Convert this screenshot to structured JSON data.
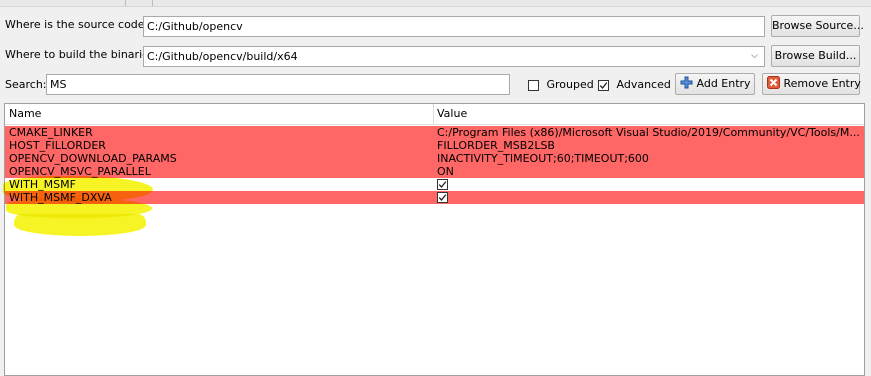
{
  "source": {
    "label": "Where is the source code:",
    "value": "C:/Github/opencv",
    "browse_label": "Browse Source..."
  },
  "build": {
    "label": "Where to build the binaries:",
    "value": "C:/Github/opencv/build/x64",
    "browse_label": "Browse Build..."
  },
  "search": {
    "label": "Search:",
    "value": "MS"
  },
  "options": {
    "grouped_label": "Grouped",
    "grouped_checked": false,
    "advanced_label": "Advanced",
    "advanced_checked": true
  },
  "toolbar": {
    "add_entry_label": "Add Entry",
    "remove_entry_label": "Remove Entry"
  },
  "table": {
    "columns": [
      "Name",
      "Value"
    ],
    "rows": [
      {
        "name": "CMAKE_LINKER",
        "value": "C:/Program Files (x86)/Microsoft Visual Studio/2019/Community/VC/Tools/M...",
        "color": "#ff6666"
      },
      {
        "name": "HOST_FILLORDER",
        "value": "FILLORDER_MSB2LSB",
        "color": "#ff6666"
      },
      {
        "name": "OPENCV_DOWNLOAD_PARAMS",
        "value": "INACTIVITY_TIMEOUT;60;TIMEOUT;600",
        "color": "#ff6666"
      },
      {
        "name": "OPENCV_MSVC_PARALLEL",
        "value": "ON",
        "color": "#ff6666"
      },
      {
        "name": "WITH_MSMF",
        "value": "checked",
        "color": "#ffffff"
      },
      {
        "name": "WITH_MSMF_DXVA",
        "value": "checked",
        "color": "#ff6666"
      }
    ]
  },
  "colors": {
    "changed_row": "#ff6666",
    "highlighter": "#f6f300"
  }
}
